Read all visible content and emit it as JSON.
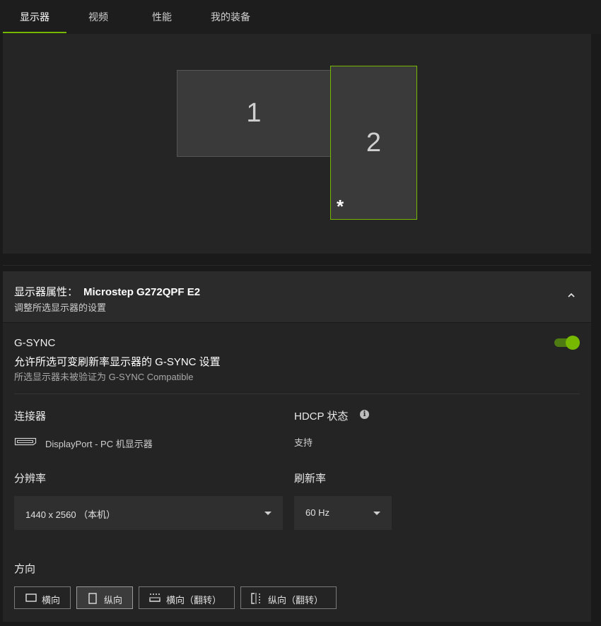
{
  "tabs": [
    {
      "label": "显示器"
    },
    {
      "label": "视频"
    },
    {
      "label": "性能"
    },
    {
      "label": "我的装备"
    }
  ],
  "arrangement": {
    "monitor_1": "1",
    "monitor_2": "2",
    "primary_marker": "*"
  },
  "properties": {
    "title_prefix": "显示器属性：",
    "model": "Microstep G272QPF E2",
    "subtitle": "调整所选显示器的设置"
  },
  "gsync": {
    "title": "G-SYNC",
    "description": "允许所选可变刷新率显示器的 G-SYNC 设置",
    "note": "所选显示器未被验证为 G-SYNC Compatible",
    "enabled": true
  },
  "connector": {
    "label": "连接器",
    "value": "DisplayPort - PC 机显示器"
  },
  "hdcp": {
    "label": "HDCP 状态",
    "value": "支持"
  },
  "resolution": {
    "label": "分辨率",
    "value": "1440 x 2560 （本机）"
  },
  "refresh": {
    "label": "刷新率",
    "value": "60 Hz"
  },
  "orientation": {
    "label": "方向",
    "options": [
      "横向",
      "纵向",
      "横向（翻转）",
      "纵向（翻转）"
    ],
    "selected": "纵向"
  },
  "colors": {
    "accent": "#76b900"
  }
}
